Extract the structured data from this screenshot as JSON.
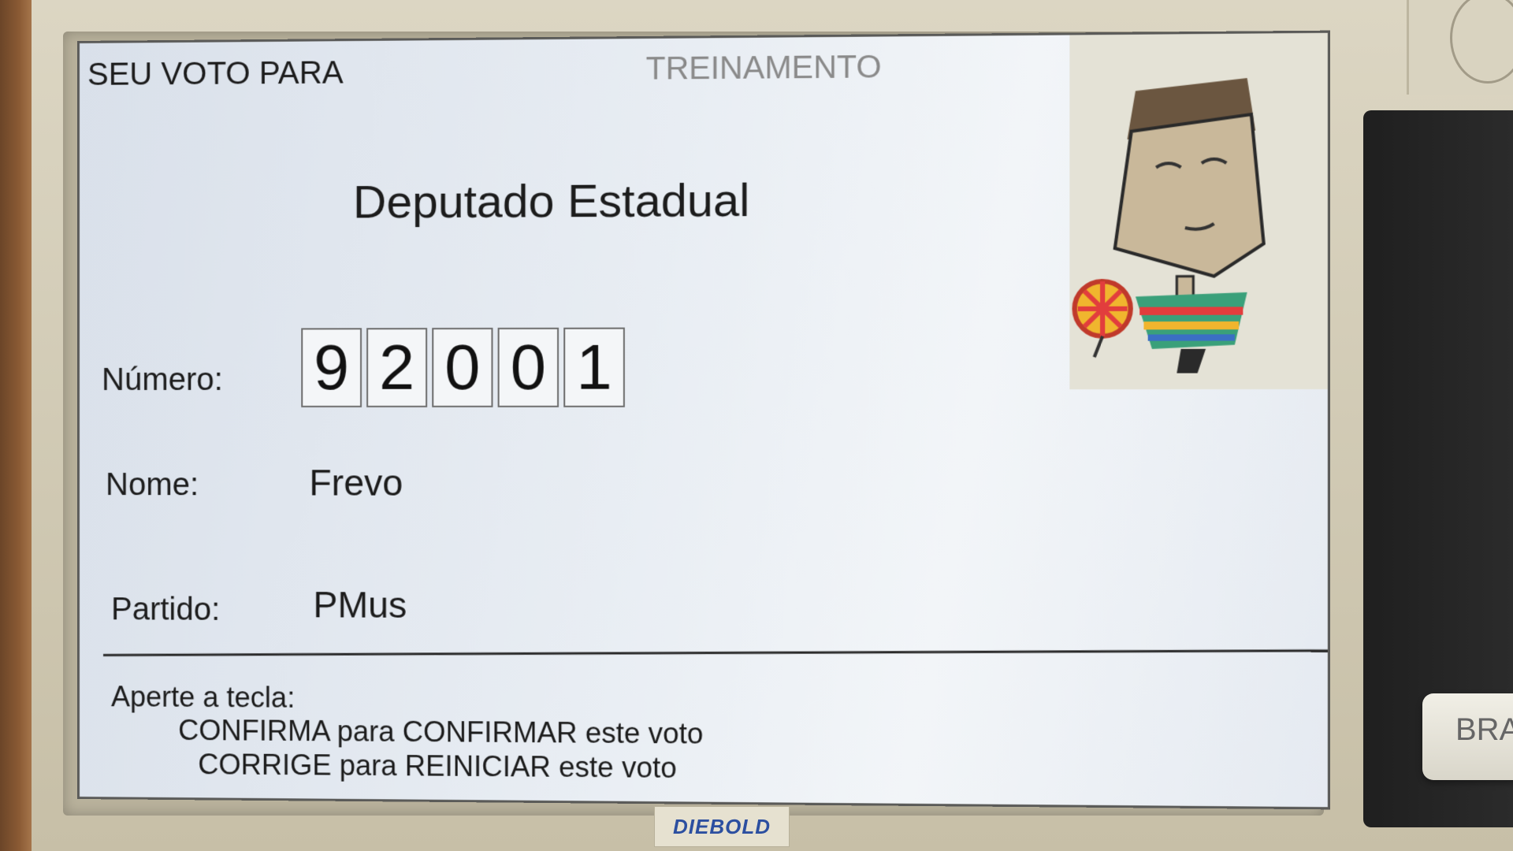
{
  "screen": {
    "header_left": "SEU VOTO PARA",
    "header_center": "TREINAMENTO",
    "office": "Deputado Estadual",
    "labels": {
      "number": "Número:",
      "name": "Nome:",
      "party": "Partido:"
    },
    "number_digits": [
      "9",
      "2",
      "0",
      "0",
      "1"
    ],
    "name": "Frevo",
    "party": "PMus",
    "instructions": {
      "title": "Aperte a tecla:",
      "line1": "CONFIRMA para CONFIRMAR este voto",
      "line2": "CORRIGE para REINICIAR este voto"
    }
  },
  "device": {
    "brand": "DIEBOLD",
    "braille_button": "BRA"
  },
  "icons": {
    "mascot": "frevo-dancer-icon",
    "emblem": "national-emblem-icon"
  },
  "colors": {
    "screen_bg": "#e8edf3",
    "bezel": "#d4cdb7",
    "brand_blue": "#2c4fa0"
  }
}
